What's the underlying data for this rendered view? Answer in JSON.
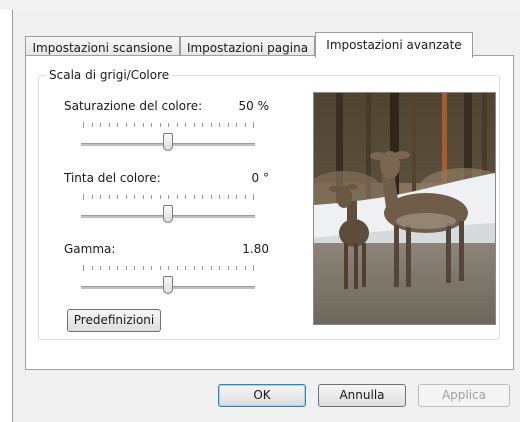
{
  "tabs": [
    {
      "label": "Impostazioni scansione",
      "active": false
    },
    {
      "label": "Impostazioni pagina",
      "active": false
    },
    {
      "label": "Impostazioni avanzate",
      "active": true
    }
  ],
  "group": {
    "title": "Scala di grigi/Colore",
    "rows": [
      {
        "label": "Saturazione del colore:",
        "value": "50 %",
        "level": 0.5
      },
      {
        "label": "Tinta del colore:",
        "value": "0 °",
        "level": 0.5
      },
      {
        "label": "Gamma:",
        "value": "1.80",
        "level": 0.5
      }
    ],
    "defaults_button": "Predefinizioni"
  },
  "preview": {
    "description_icon": "deer-photo-icon"
  },
  "footer": {
    "ok": "OK",
    "cancel": "Annulla",
    "apply": "Applica"
  },
  "colors": {
    "default_button_border": "#3c7fb1",
    "panel": "#ffffff",
    "dialog": "#f0f0f0"
  }
}
